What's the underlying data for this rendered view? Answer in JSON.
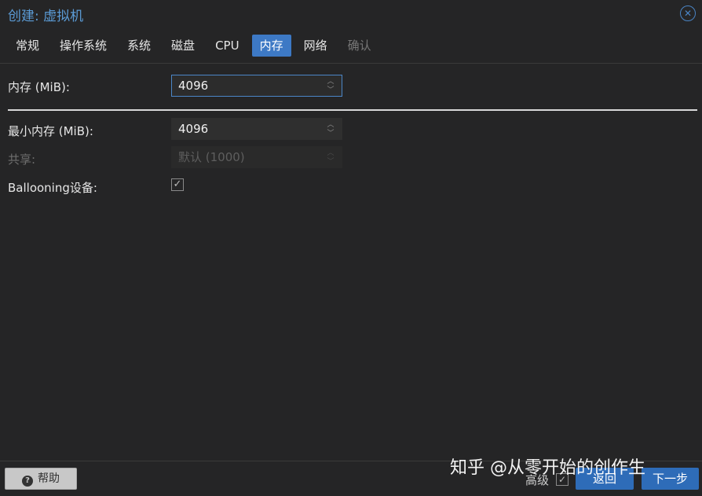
{
  "window": {
    "title": "创建: 虚拟机",
    "close_icon": "close-icon"
  },
  "tabs": [
    {
      "label": "常规",
      "state": "normal"
    },
    {
      "label": "操作系统",
      "state": "normal"
    },
    {
      "label": "系统",
      "state": "normal"
    },
    {
      "label": "磁盘",
      "state": "normal"
    },
    {
      "label": "CPU",
      "state": "normal"
    },
    {
      "label": "内存",
      "state": "active"
    },
    {
      "label": "网络",
      "state": "normal"
    },
    {
      "label": "确认",
      "state": "disabled"
    }
  ],
  "memory": {
    "label": "内存 (MiB):",
    "value": "4096"
  },
  "min_memory": {
    "label": "最小内存 (MiB):",
    "value": "4096"
  },
  "shares": {
    "label": "共享:",
    "placeholder": "默认 (1000)",
    "disabled": true
  },
  "ballooning": {
    "label": "Ballooning设备:",
    "checked": true
  },
  "footer": {
    "help_label": "帮助",
    "advanced_label": "高级",
    "advanced_checked": true,
    "back_label": "返回",
    "next_label": "下一步"
  },
  "watermark": "知乎 @从零开始的创作生",
  "colors": {
    "accent": "#3d79c5",
    "background": "#252526",
    "title": "#5b9bd5"
  }
}
